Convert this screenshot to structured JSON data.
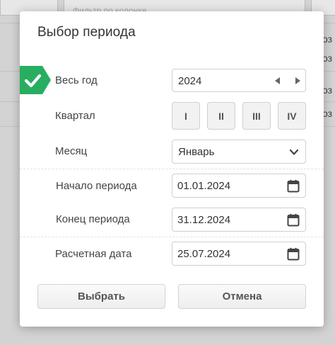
{
  "background": {
    "filter_placeholder": "Фильтр по колонке",
    "row_cells": [
      "оз",
      "оз",
      "оз",
      "оз"
    ]
  },
  "dialog": {
    "title": "Выбор периода",
    "full_year": {
      "label": "Весь год",
      "selected": true,
      "year_value": "2024",
      "prev_icon": "caret-left-icon",
      "next_icon": "caret-right-icon"
    },
    "quarter": {
      "label": "Квартал",
      "buttons": [
        "I",
        "II",
        "III",
        "IV"
      ]
    },
    "month": {
      "label": "Месяц",
      "value": "Январь",
      "icon": "chevron-down-icon"
    },
    "period_start": {
      "label": "Начало периода",
      "value": "01.01.2024",
      "icon": "calendar-icon"
    },
    "period_end": {
      "label": "Конец периода",
      "value": "31.12.2024",
      "icon": "calendar-icon"
    },
    "calc_date": {
      "label": "Расчетная дата",
      "value": "25.07.2024",
      "icon": "calendar-icon"
    },
    "buttons": {
      "select": "Выбрать",
      "cancel": "Отмена"
    }
  },
  "colors": {
    "accent_green": "#27ae60",
    "border": "#cfcfcf",
    "text": "#333333"
  }
}
